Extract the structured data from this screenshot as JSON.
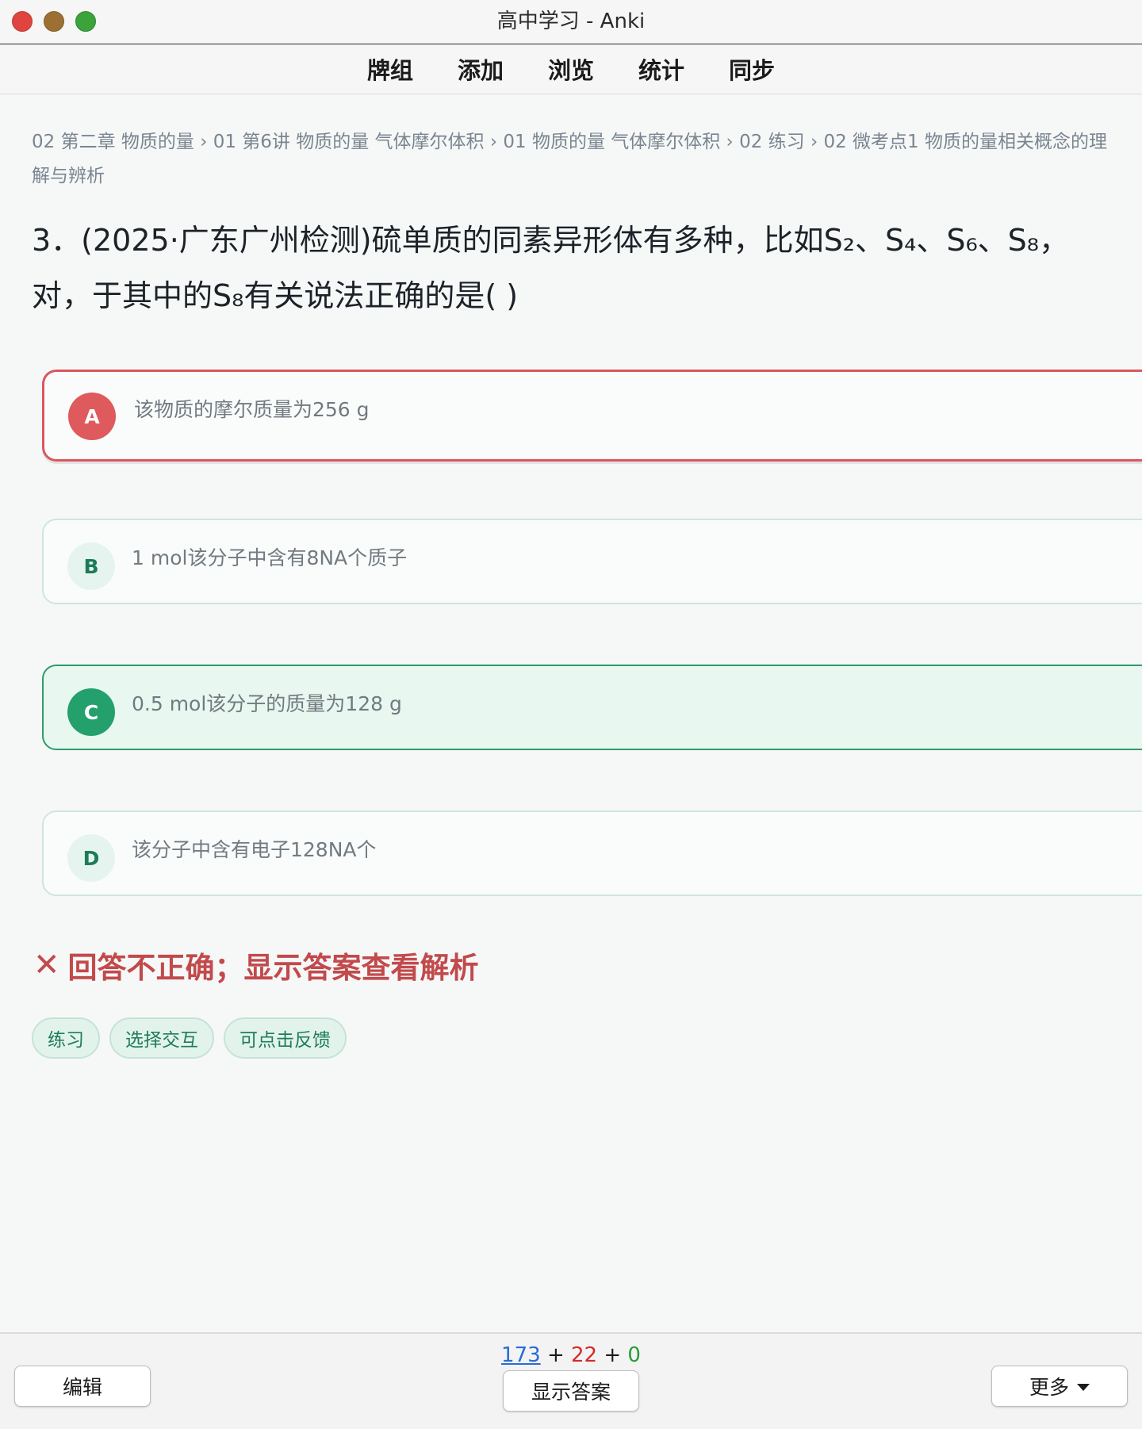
{
  "window": {
    "title": "高中学习 - Anki"
  },
  "toolbar": {
    "items": [
      "牌组",
      "添加",
      "浏览",
      "统计",
      "同步"
    ]
  },
  "breadcrumb": "02 第二章 物质的量 › 01 第6讲 物质的量 气体摩尔体积 › 01 物质的量 气体摩尔体积 › 02 练习 › 02 微考点1 物质的量相关概念的理解与辨析",
  "question": "3．(2025·广东广州检测)硫单质的同素异形体有多种，比如S₂、S₄、S₆、S₈，对，于其中的S₈有关说法正确的是( )",
  "options": [
    {
      "letter": "A",
      "text": "该物质的摩尔质量为256 g",
      "state": "wrong-selected"
    },
    {
      "letter": "B",
      "text": "1 mol该分子中含有8NA个质子",
      "state": "normal"
    },
    {
      "letter": "C",
      "text": "0.5 mol该分子的质量为128 g",
      "state": "correct"
    },
    {
      "letter": "D",
      "text": "该分子中含有电子128NA个",
      "state": "normal"
    }
  ],
  "result": {
    "icon": "✕",
    "text": "回答不正确；显示答案查看解析",
    "color": "#c24a4c"
  },
  "tags": [
    "练习",
    "选择交互",
    "可点击反馈"
  ],
  "bottom": {
    "counts": {
      "new": "173",
      "learn": "22",
      "review": "0",
      "sep": "+"
    },
    "edit_label": "编辑",
    "show_answer_label": "显示答案",
    "more_label": "更多"
  },
  "colors": {
    "wrong": "#de5a5c",
    "correct": "#23a06c",
    "tag": "#1f7c5a"
  }
}
